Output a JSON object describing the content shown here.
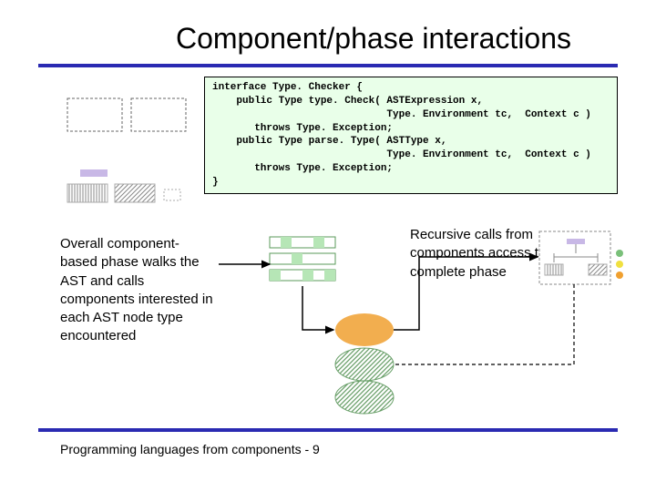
{
  "title": "Component/phase interactions",
  "code": "interface Type. Checker {\n    public Type type. Check( ASTExpression x,\n                             Type. Environment tc,  Context c )\n       throws Type. Exception;\n    public Type parse. Type( ASTType x,\n                             Type. Environment tc,  Context c )\n       throws Type. Exception;\n}",
  "left_caption": "Overall component-based phase walks the AST and calls components interested in each AST node type encountered",
  "right_caption": "Recursive calls from components access the complete phase",
  "footer": "Programming languages from components -  9",
  "colors": {
    "rule": "#2a2ab2",
    "codebg": "#e9ffe9",
    "purple": "#c8b8e6",
    "green": "#7ac07a",
    "hatch_green": "#6aa06a",
    "yellow": "#f0e040",
    "orange": "#f0a030"
  }
}
